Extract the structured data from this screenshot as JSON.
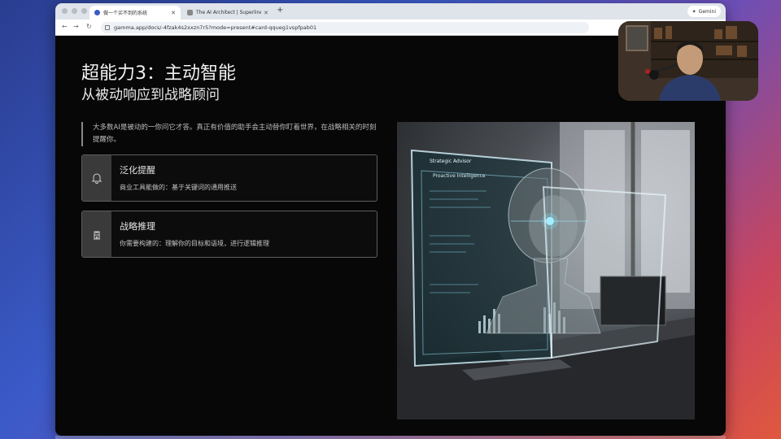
{
  "browser": {
    "tabs": [
      {
        "label": "做一个买不到的系统",
        "active": true
      },
      {
        "label": "The AI Architect | Superlinear",
        "active": false
      }
    ],
    "new_tab": "+",
    "gemini_label": "Gemini",
    "url": "gamma.app/docs/-4fzak4s2xxzn7r5?mode=present#card-qqueg1vspfpab01"
  },
  "slide": {
    "title": "超能力3：主动智能",
    "subtitle": "从被动响应到战略顾问",
    "quote": "大多数AI是被动的一你问它才答。真正有价值的助手会主动替你盯着世界，在战略相关的时刻提醒你。",
    "cards": [
      {
        "title": "泛化提醒",
        "desc": "商业工具能做的：基于关键词的通用推送",
        "icon": "bell-icon"
      },
      {
        "title": "战略推理",
        "desc": "你需要构建的：理解你的目标和语境，进行逻辑推理",
        "icon": "chess-castle-icon"
      }
    ],
    "image": {
      "panel_title": "Strategic Advisor",
      "panel_subtitle": "Proactive Intelligence"
    }
  }
}
